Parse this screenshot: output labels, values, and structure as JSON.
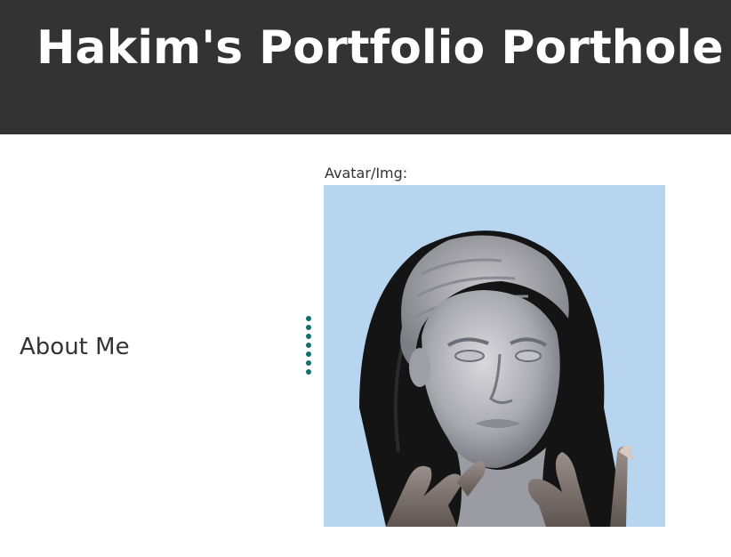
{
  "header": {
    "title": "Hakim's Portfolio Porthole",
    "background_color": "#333333"
  },
  "main": {
    "about_heading": "About Me",
    "avatar_label": "Avatar/Img:",
    "divider_icon": "vertical-dots-icon",
    "accent_color": "#0f7070",
    "avatar_background_color": "#b7d5ef"
  }
}
